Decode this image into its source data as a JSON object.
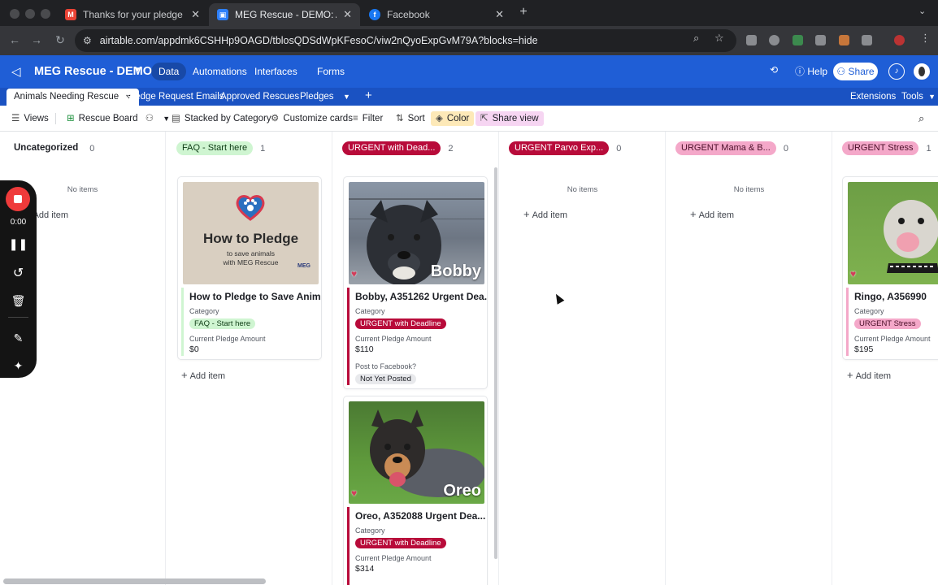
{
  "browser": {
    "tabs": [
      {
        "title": "Thanks for your pledge towar",
        "favicon": "gmail-icon",
        "favicon_color": "#ea4335"
      },
      {
        "title": "MEG Rescue - DEMO: Animal",
        "favicon": "airtable-icon",
        "favicon_color": "#2d7ff9"
      },
      {
        "title": "Facebook",
        "favicon": "facebook-icon",
        "favicon_color": "#1877f2"
      }
    ],
    "url": "airtable.com/appdmk6CSHHp9OAGD/tblosQDSdWpKFesoC/viw2nQyoExpGvM79A?blocks=hide"
  },
  "app": {
    "base_name": "MEG Rescue - DEMO",
    "nav": [
      "Data",
      "Automations",
      "Interfaces",
      "Forms"
    ],
    "help": "Help",
    "share": "Share",
    "accent": "#1f5ed6"
  },
  "tables": {
    "items": [
      "Animals Needing Rescue",
      "Pledge Request Emails",
      "Approved Rescues",
      "Pledges"
    ],
    "extensions": "Extensions",
    "tools": "Tools"
  },
  "viewbar": {
    "views": "Views",
    "view_name": "Rescue Board",
    "stacked": "Stacked by Category",
    "customize": "Customize cards",
    "filter": "Filter",
    "sort": "Sort",
    "color": "Color",
    "share_view": "Share view"
  },
  "board": {
    "no_items": "No items",
    "add_item": "Add item",
    "field_category": "Category",
    "field_pledge": "Current Pledge Amount",
    "field_facebook": "Post to Facebook?",
    "columns": [
      {
        "name": "Uncategorized",
        "count": "0"
      },
      {
        "name": "FAQ - Start here",
        "count": "1"
      },
      {
        "name": "URGENT with Dead...",
        "count": "2"
      },
      {
        "name": "URGENT Parvo Exp...",
        "count": "0"
      },
      {
        "name": "URGENT Mama & B...",
        "count": "0"
      },
      {
        "name": "URGENT Stress",
        "count": "1"
      }
    ],
    "cards": {
      "howto": {
        "title": "How to Pledge to Save Anim...",
        "category": "FAQ - Start here",
        "pledge": "$0",
        "image_heading": "How to Pledge",
        "image_sub1": "to save animals",
        "image_sub2": "with MEG Rescue",
        "image_logo": "MEG"
      },
      "bobby": {
        "title": "Bobby, A351262 Urgent Dea...",
        "category": "URGENT with Deadline",
        "pledge": "$110",
        "facebook": "Not Yet Posted",
        "photo_label": "Bobby"
      },
      "oreo": {
        "title": "Oreo, A352088 Urgent Dea...",
        "category": "URGENT with Deadline",
        "pledge": "$314",
        "photo_label": "Oreo"
      },
      "ringo": {
        "title": "Ringo, A356990",
        "category": "URGENT Stress",
        "pledge": "$195"
      }
    }
  },
  "recorder": {
    "time": "0:00"
  }
}
